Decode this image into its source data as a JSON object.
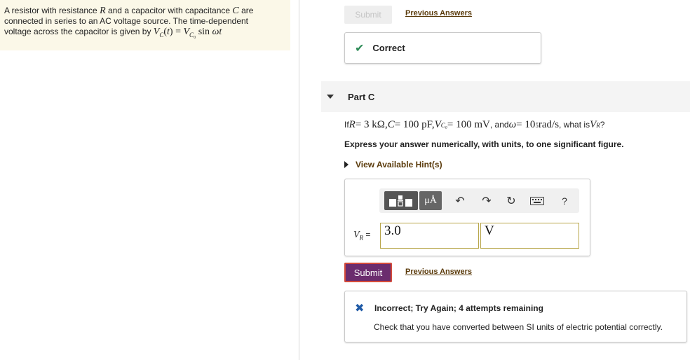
{
  "problem": {
    "text_1": "A resistor with resistance ",
    "var_R": "R",
    "text_2": " and a capacitor with capacitance ",
    "var_C": "C",
    "text_3": " are",
    "line_2": "connected in series to an AC voltage source. The time-dependent",
    "line_3_text": "voltage across the capacitor is given by ",
    "line_3_math": "V⁣C(t) = VC₀ sin ωt"
  },
  "part_b": {
    "submit_label": "Submit",
    "previous_answers_label": "Previous Answers",
    "feedback": "Correct"
  },
  "part_c": {
    "title": "Part C",
    "q_if": "If ",
    "q_R": "R",
    "q_eq1": " = 3 kΩ, ",
    "q_C": "C",
    "q_eq2": " = 100 pF, ",
    "q_V": "V",
    "q_Vsub": "C₀",
    "q_eq3": " = 100 mV",
    "q_and": ", and ",
    "q_w": "ω",
    "q_eq4": " = 10",
    "q_exp": "5",
    "q_eq5": " rad/s",
    "q_what": ", what is ",
    "q_VR": "V",
    "q_VRsub": "R",
    "q_end": "?",
    "instructions": "Express your answer numerically, with units, to one significant figure.",
    "hints_label": "View Available Hint(s)",
    "toolbar": {
      "units_label": "μÅ",
      "undo": "↶",
      "redo": "↷",
      "reset": "↻",
      "help": "?"
    },
    "answer_var": "V",
    "answer_var_sub": "R",
    "answer_eq": " =",
    "value": "3.0",
    "units": "V",
    "submit_label": "Submit",
    "previous_answers_label": "Previous Answers",
    "feedback_title": "Incorrect; Try Again; 4 attempts remaining",
    "feedback_text": "Check that you have converted between SI units of electric potential correctly."
  }
}
